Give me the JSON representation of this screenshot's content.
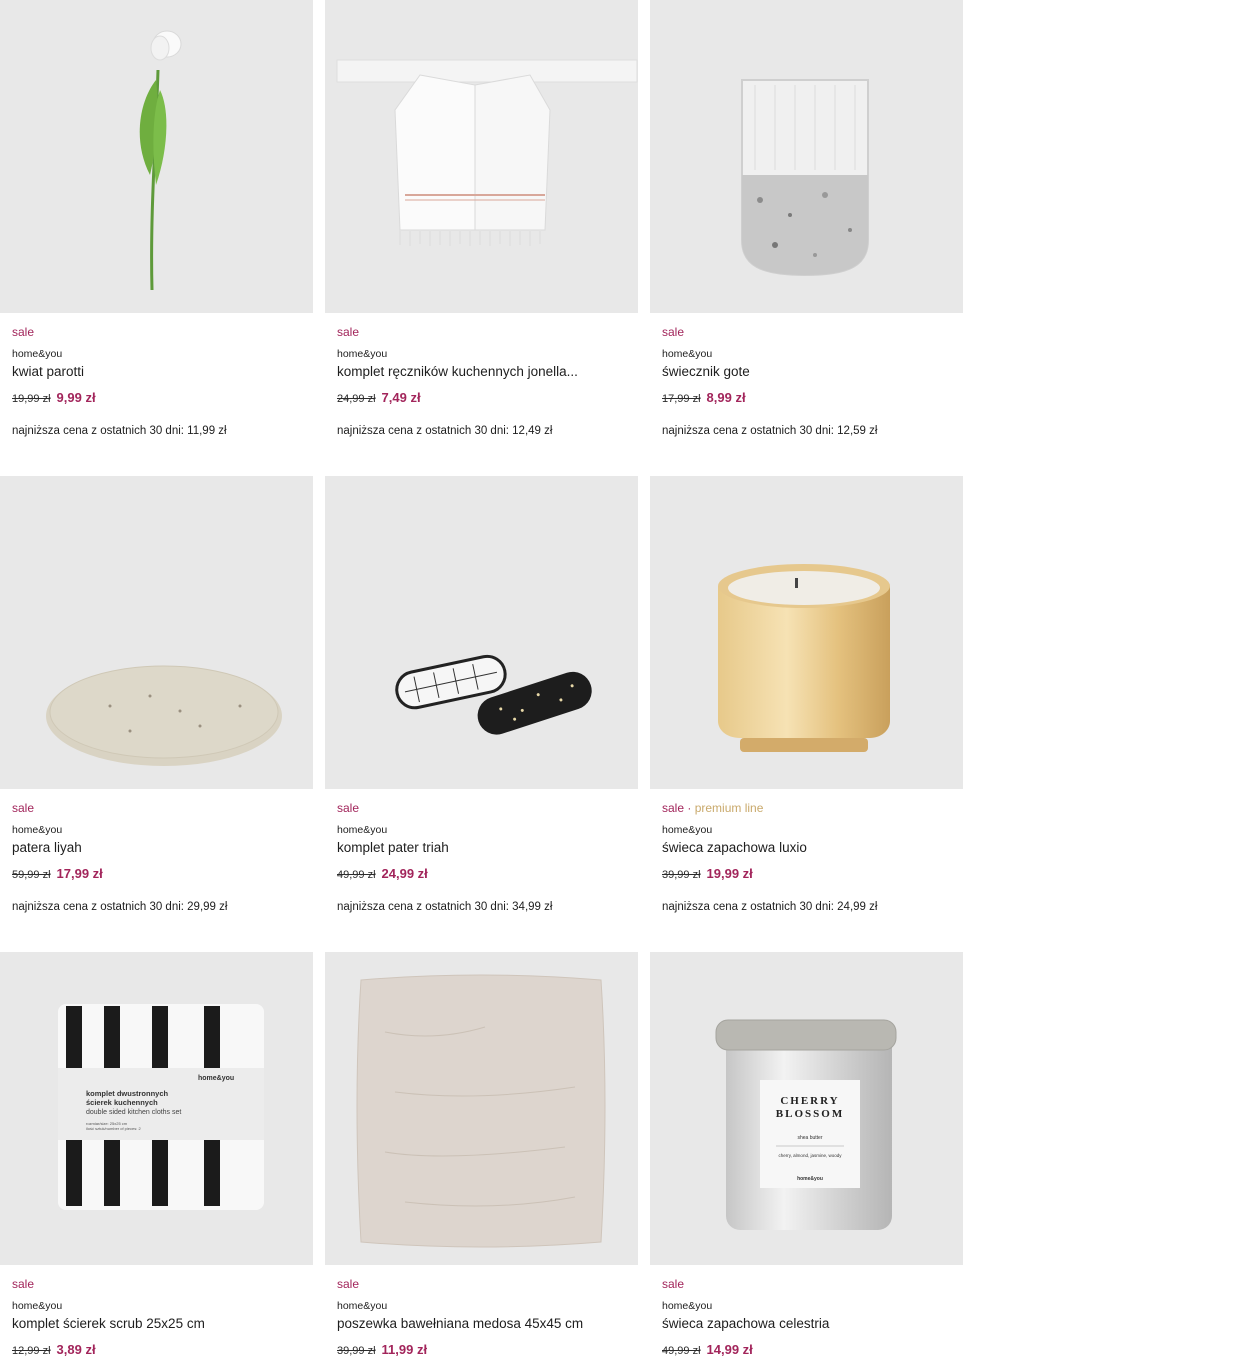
{
  "colors": {
    "sale": "#a2255b",
    "premium": "#c9a96b",
    "image_bg": "#e8e8e8"
  },
  "products": [
    {
      "tag": "sale",
      "brand": "home&you",
      "name": "kwiat parotti",
      "old_price": "19,99 zł",
      "price": "9,99 zł",
      "lowest": "najniższa cena z ostatnich 30 dni: 11,99 zł",
      "image": "tulip-flower"
    },
    {
      "tag": "sale",
      "brand": "home&you",
      "name": "komplet ręczników kuchennych jonella...",
      "old_price": "24,99 zł",
      "price": "7,49 zł",
      "lowest": "najniższa cena z ostatnich 30 dni: 12,49 zł",
      "image": "kitchen-towels"
    },
    {
      "tag": "sale",
      "brand": "home&you",
      "name": "świecznik gote",
      "old_price": "17,99 zł",
      "price": "8,99 zł",
      "lowest": "najniższa cena z ostatnich 30 dni: 12,59 zł",
      "image": "glass-candle-holder"
    },
    {
      "tag": "sale",
      "brand": "home&you",
      "name": "patera liyah",
      "old_price": "59,99 zł",
      "price": "17,99 zł",
      "lowest": "najniższa cena z ostatnich 30 dni: 29,99 zł",
      "image": "plate"
    },
    {
      "tag": "sale",
      "brand": "home&you",
      "name": "komplet pater triah",
      "old_price": "49,99 zł",
      "price": "24,99 zł",
      "lowest": "najniższa cena z ostatnich 30 dni: 34,99 zł",
      "image": "serving-plates"
    },
    {
      "tag": "sale",
      "tag2": "premium line",
      "brand": "home&you",
      "name": "świeca zapachowa luxio",
      "old_price": "39,99 zł",
      "price": "19,99 zł",
      "lowest": "najniższa cena z ostatnich 30 dni: 24,99 zł",
      "image": "gold-candle"
    },
    {
      "tag": "sale",
      "brand": "home&you",
      "name": "komplet ścierek scrub 25x25 cm",
      "old_price": "12,99 zł",
      "price": "3,89 zł",
      "lowest": "",
      "image": "cloths-set",
      "package": {
        "logo": "home&you",
        "title1": "komplet dwustronnych",
        "title2": "ścierek kuchennych",
        "subtitle": "double sided kitchen cloths set",
        "size": "rozmiar/size: 25x25 cm",
        "count": "ilość sztuk/number of pieces: 2"
      }
    },
    {
      "tag": "sale",
      "brand": "home&you",
      "name": "poszewka bawełniana medosa 45x45 cm",
      "old_price": "39,99 zł",
      "price": "11,99 zł",
      "lowest": "",
      "image": "pillow"
    },
    {
      "tag": "sale",
      "brand": "home&you",
      "name": "świeca zapachowa celestria",
      "old_price": "49,99 zł",
      "price": "14,99 zł",
      "lowest": "",
      "image": "silver-candle",
      "label": {
        "line1": "CHERRY",
        "line2": "BLOSSOM",
        "note": "shea butter",
        "notes": "cherry, almond, jasmine, woody",
        "logo": "home&you"
      }
    }
  ]
}
